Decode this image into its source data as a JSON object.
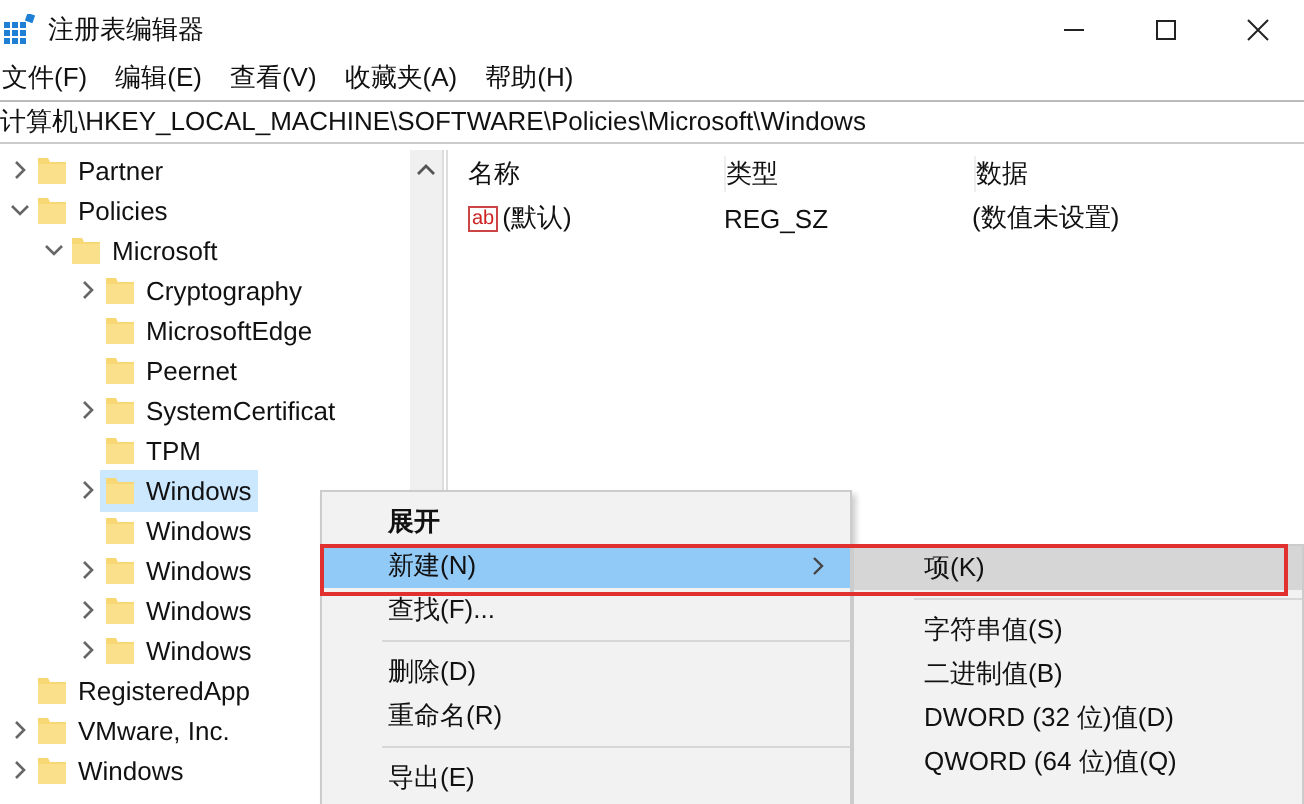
{
  "window": {
    "title": "注册表编辑器"
  },
  "menu_bar": [
    "文件(F)",
    "编辑(E)",
    "查看(V)",
    "收藏夹(A)",
    "帮助(H)"
  ],
  "address": "计算机\\HKEY_LOCAL_MACHINE\\SOFTWARE\\Policies\\Microsoft\\Windows",
  "tree": [
    {
      "label": "Partner",
      "kind": "branch",
      "expanded": false,
      "selected": false
    },
    {
      "label": "Policies",
      "kind": "branch",
      "expanded": true,
      "selected": false,
      "children": [
        {
          "label": "Microsoft",
          "kind": "branch",
          "expanded": true,
          "selected": false,
          "children": [
            {
              "label": "Cryptography",
              "kind": "branch",
              "expanded": false,
              "selected": false
            },
            {
              "label": "MicrosoftEdge",
              "kind": "leaf",
              "selected": false
            },
            {
              "label": "Peernet",
              "kind": "leaf",
              "selected": false
            },
            {
              "label": "SystemCertificat",
              "kind": "branch",
              "expanded": false,
              "selected": false
            },
            {
              "label": "TPM",
              "kind": "leaf",
              "selected": false
            },
            {
              "label": "Windows",
              "kind": "branch",
              "expanded": false,
              "selected": true
            },
            {
              "label": "Windows",
              "kind": "leaf",
              "selected": false
            },
            {
              "label": "Windows",
              "kind": "branch",
              "expanded": false,
              "selected": false
            },
            {
              "label": "Windows",
              "kind": "branch",
              "expanded": false,
              "selected": false
            },
            {
              "label": "Windows",
              "kind": "branch",
              "expanded": false,
              "selected": false
            }
          ]
        }
      ]
    },
    {
      "label": "RegisteredApp",
      "kind": "leaf",
      "selected": false
    },
    {
      "label": "VMware, Inc.",
      "kind": "branch",
      "expanded": false,
      "selected": false
    },
    {
      "label": "Windows",
      "kind": "branch",
      "expanded": false,
      "selected": false
    }
  ],
  "values_table": {
    "columns": [
      "名称",
      "类型",
      "数据"
    ],
    "rows": [
      {
        "icon_text": "ab",
        "name": "(默认)",
        "type": "REG_SZ",
        "data": "(数值未设置)"
      }
    ]
  },
  "context_menu": [
    {
      "kind": "item",
      "label": "展开",
      "bold": true,
      "selected": false
    },
    {
      "kind": "submenu",
      "label": "新建(N)",
      "bold": false,
      "selected": true
    },
    {
      "kind": "item",
      "label": "查找(F)...",
      "bold": false,
      "selected": false
    },
    {
      "kind": "separator"
    },
    {
      "kind": "item",
      "label": "删除(D)",
      "bold": false,
      "selected": false
    },
    {
      "kind": "item",
      "label": "重命名(R)",
      "bold": false,
      "selected": false
    },
    {
      "kind": "separator"
    },
    {
      "kind": "item",
      "label": "导出(E)",
      "bold": false,
      "selected": false
    }
  ],
  "submenu": [
    {
      "kind": "item",
      "label": "项(K)",
      "selected": true
    },
    {
      "kind": "separator"
    },
    {
      "kind": "item",
      "label": "字符串值(S)",
      "selected": false
    },
    {
      "kind": "item",
      "label": "二进制值(B)",
      "selected": false
    },
    {
      "kind": "item",
      "label": "DWORD (32 位)值(D)",
      "selected": false
    },
    {
      "kind": "item",
      "label": "QWORD (64 位)值(Q)",
      "selected": false
    }
  ]
}
